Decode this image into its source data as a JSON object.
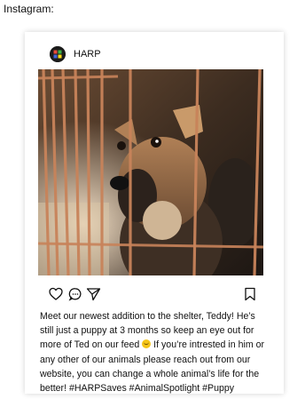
{
  "page_label": "Instagram:",
  "post": {
    "username": "HARP",
    "avatar_icon": "harp-logo-icon",
    "image_alt": "puppy-behind-cage-photo",
    "actions": {
      "like_icon": "heart-icon",
      "comment_icon": "comment-icon",
      "share_icon": "send-icon",
      "save_icon": "bookmark-icon"
    },
    "caption": {
      "part1": "Meet our newest addition to the shelter, Teddy! He’s still just a puppy at 3 months so keep an eye out for more of Ted on our feed ",
      "emoji": "smiling-face-emoji",
      "part2": " If you’re intrested in him or any other of our animals please reach out from our website, you can change a whole animal’s life for the better! #HARPSaves #AnimalSpotlight #Puppy"
    }
  },
  "colors": {
    "accent_icon": "#111111",
    "emoji": "#f5c518"
  }
}
